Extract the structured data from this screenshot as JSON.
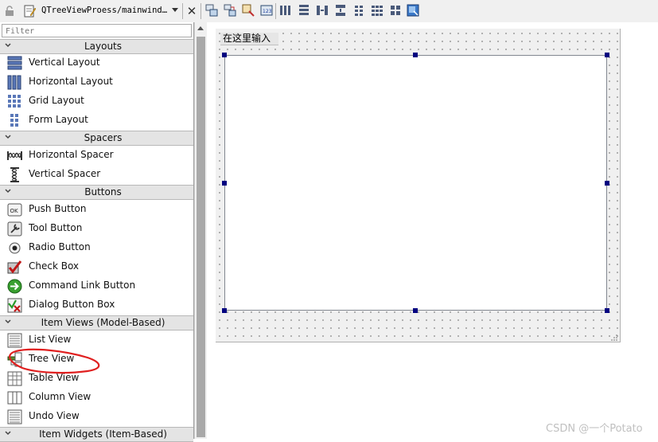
{
  "toolbar": {
    "file_title": "QTreeViewProess/mainwind…",
    "icons": [
      "lock-icon",
      "file-icon",
      "dropdown-arrow-icon",
      "close-icon",
      "edit-widgets-icon",
      "edit-signals-slots-icon",
      "edit-buddies-icon",
      "edit-tab-order-icon",
      "layout-horizontal-icon",
      "layout-vertical-icon",
      "layout-horizontal-splitter-icon",
      "layout-vertical-splitter-icon",
      "layout-form-icon",
      "layout-grid-icon",
      "break-layout-icon",
      "adjust-size-icon"
    ]
  },
  "widgetbox": {
    "filter_placeholder": "Filter",
    "categories": [
      {
        "label": "Layouts",
        "items": [
          {
            "label": "Vertical Layout",
            "icon": "vertical-layout-icon"
          },
          {
            "label": "Horizontal Layout",
            "icon": "horizontal-layout-icon"
          },
          {
            "label": "Grid Layout",
            "icon": "grid-layout-icon"
          },
          {
            "label": "Form Layout",
            "icon": "form-layout-icon"
          }
        ]
      },
      {
        "label": "Spacers",
        "items": [
          {
            "label": "Horizontal Spacer",
            "icon": "horizontal-spacer-icon"
          },
          {
            "label": "Vertical Spacer",
            "icon": "vertical-spacer-icon"
          }
        ]
      },
      {
        "label": "Buttons",
        "items": [
          {
            "label": "Push Button",
            "icon": "push-button-icon"
          },
          {
            "label": "Tool Button",
            "icon": "tool-button-icon"
          },
          {
            "label": "Radio Button",
            "icon": "radio-button-icon"
          },
          {
            "label": "Check Box",
            "icon": "check-box-icon"
          },
          {
            "label": "Command Link Button",
            "icon": "command-link-icon"
          },
          {
            "label": "Dialog Button Box",
            "icon": "dialog-button-box-icon"
          }
        ]
      },
      {
        "label": "Item Views (Model-Based)",
        "items": [
          {
            "label": "List View",
            "icon": "list-view-icon"
          },
          {
            "label": "Tree View",
            "icon": "tree-view-icon"
          },
          {
            "label": "Table View",
            "icon": "table-view-icon"
          },
          {
            "label": "Column View",
            "icon": "column-view-icon"
          },
          {
            "label": "Undo View",
            "icon": "undo-view-icon"
          }
        ]
      },
      {
        "label": "Item Widgets (Item-Based)",
        "items": []
      }
    ]
  },
  "form": {
    "menu_placeholder": "在这里输入"
  },
  "watermark": "CSDN @一个Potato",
  "colors": {
    "selection_handle": "#000080",
    "annotation_stroke": "#e02020",
    "category_background": "#e4e4e4"
  }
}
